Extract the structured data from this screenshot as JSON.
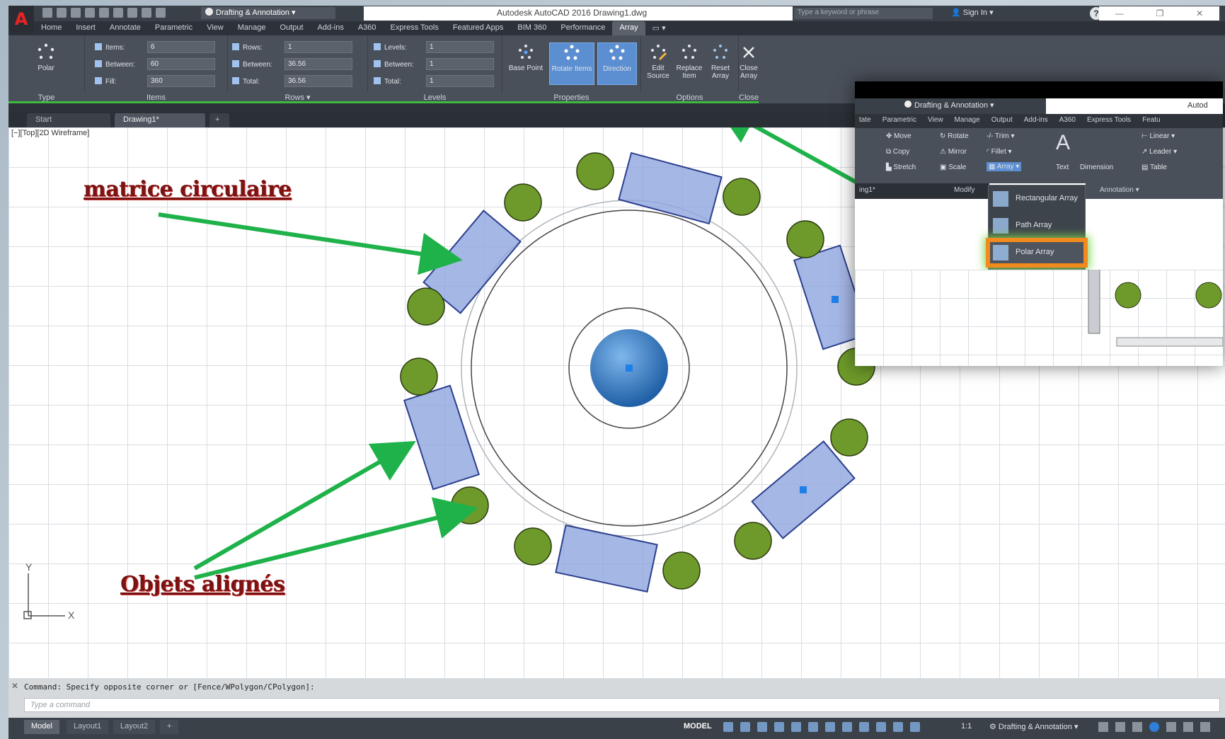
{
  "window": {
    "app_title": "Autodesk AutoCAD 2016   Drawing1.dwg",
    "workspace": "Drafting & Annotation",
    "search_placeholder": "Type a keyword or phrase",
    "sign_in": "Sign In",
    "help": "?"
  },
  "ribbon_tabs": [
    "Home",
    "Insert",
    "Annotate",
    "Parametric",
    "View",
    "Manage",
    "Output",
    "Add-ins",
    "A360",
    "Express Tools",
    "Featured Apps",
    "BIM 360",
    "Performance",
    "Array"
  ],
  "ribbon_active_tab": "Array",
  "ribbon": {
    "type_panel": {
      "title": "Type",
      "button": "Polar"
    },
    "items_panel": {
      "title": "Items",
      "fields": [
        {
          "label": "Items:",
          "value": "6"
        },
        {
          "label": "Between:",
          "value": "60"
        },
        {
          "label": "Fill:",
          "value": "360"
        }
      ]
    },
    "rows_panel": {
      "title": "Rows ▾",
      "fields": [
        {
          "label": "Rows:",
          "value": "1"
        },
        {
          "label": "Between:",
          "value": "36.56"
        },
        {
          "label": "Total:",
          "value": "36.56"
        }
      ]
    },
    "levels_panel": {
      "title": "Levels",
      "fields": [
        {
          "label": "Levels:",
          "value": "1"
        },
        {
          "label": "Between:",
          "value": "1"
        },
        {
          "label": "Total:",
          "value": "1"
        }
      ]
    },
    "properties_panel": {
      "title": "Properties",
      "buttons": [
        "Base Point",
        "Rotate Items",
        "Direction"
      ]
    },
    "options_panel": {
      "title": "Options",
      "buttons": [
        "Edit Source",
        "Replace Item",
        "Reset Array"
      ]
    },
    "close_panel": {
      "title": "Close",
      "button": "Close Array"
    }
  },
  "file_tabs": [
    "Start",
    "Drawing1*",
    "+"
  ],
  "viewport_label": "[−][Top][2D Wireframe]",
  "annotations": {
    "top": "matrice circulaire",
    "bottom": "Objets alignés"
  },
  "overlay": {
    "workspace": "Drafting & Annotation",
    "title_fragment": "Autod",
    "tabs": [
      "tate",
      "Parametric",
      "View",
      "Manage",
      "Output",
      "Add-ins",
      "A360",
      "Express Tools",
      "Featu"
    ],
    "modify_tools": [
      "Move",
      "Rotate",
      "Trim",
      "Copy",
      "Mirror",
      "Fillet",
      "Stretch",
      "Scale",
      "Array"
    ],
    "annotation_tools": [
      "Text",
      "Dimension",
      "Linear",
      "Leader",
      "Table"
    ],
    "panel_labels": [
      "Modify",
      "Annotation ▾"
    ],
    "file_tab": "ing1*",
    "menu_items": [
      "Rectangular Array",
      "Path Array",
      "Polar Array"
    ],
    "highlighted_item": "Polar Array"
  },
  "command": {
    "history": "Command: Specify opposite corner or [Fence/WPolygon/CPolygon]:",
    "placeholder": "Type a command"
  },
  "status": {
    "layout_tabs": [
      "Model",
      "Layout1",
      "Layout2",
      "+"
    ],
    "model": "MODEL",
    "scale": "1:1",
    "workspace": "Drafting & Annotation"
  },
  "axes": {
    "x": "X",
    "y": "Y"
  }
}
